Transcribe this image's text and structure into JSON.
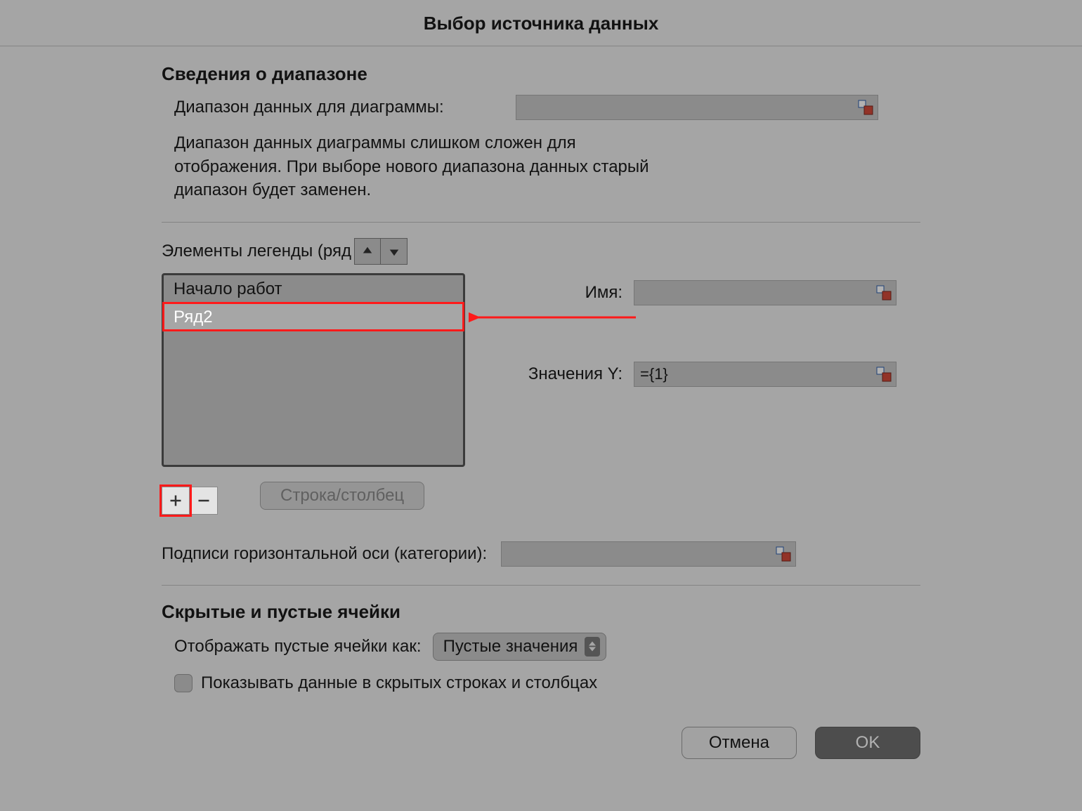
{
  "title": "Выбор источника данных",
  "range_section": {
    "heading": "Сведения о диапазоне",
    "range_label": "Диапазон данных для диаграммы:",
    "range_value": "",
    "note": "Диапазон данных диаграммы слишком сложен для отображения. При выборе нового диапазона данных старый диапазон будет заменен."
  },
  "legend_section": {
    "heading": "Элементы легенды (ряд",
    "items": [
      "Начало работ",
      "Ряд2"
    ],
    "selected_index": 1,
    "name_label": "Имя:",
    "name_value": "",
    "yvalues_label": "Значения Y:",
    "yvalues_value": "={1}",
    "switch_btn": "Строка/столбец"
  },
  "axis_section": {
    "label": "Подписи горизонтальной оси (категории):",
    "value": ""
  },
  "hidden_section": {
    "heading": "Скрытые и пустые ячейки",
    "empty_label": "Отображать пустые ячейки как:",
    "empty_selected": "Пустые значения",
    "show_hidden_label": "Показывать данные в скрытых строках и столбцах",
    "show_hidden_checked": false
  },
  "footer": {
    "cancel": "Отмена",
    "ok": "OK"
  },
  "icons": {
    "range_picker": "range-picker-icon",
    "up": "arrow-up-icon",
    "down": "arrow-down-icon",
    "plus": "plus-icon",
    "minus": "minus-icon",
    "updown": "updown-icon"
  }
}
